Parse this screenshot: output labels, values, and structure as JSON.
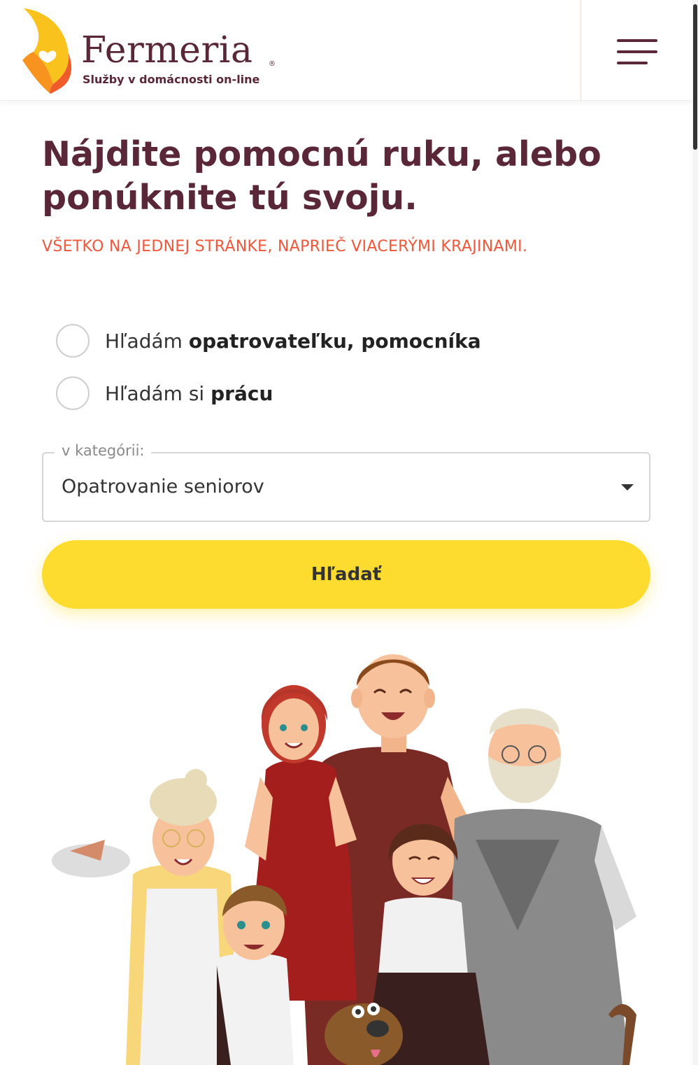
{
  "brand": {
    "name": "Fermeria",
    "registered": "®",
    "tagline": "Služby v domácnosti on-line",
    "colors": {
      "primary": "#5a2738",
      "accent": "#f0573b",
      "flame_yellow": "#f9c21c",
      "flame_orange": "#f26d2a"
    }
  },
  "header": {
    "menu_icon": "hamburger-menu-icon"
  },
  "hero": {
    "headline": "Nájdite pomocnú ruku, alebo ponúknite tú svoju.",
    "subheadline": "VŠETKO NA JEDNEJ STRÁNKE, NAPRIEČ VIACERÝMI KRAJINAMI."
  },
  "options": [
    {
      "prefix": "Hľadám ",
      "bold": "opatrovateľku, pomocníka",
      "selected": false
    },
    {
      "prefix": "Hľadám si ",
      "bold": "prácu",
      "selected": false
    }
  ],
  "category": {
    "legend": "v kategórii:",
    "value": "Opatrovanie seniorov"
  },
  "search_button": {
    "label": "Hľadať",
    "color": "#fedc2f"
  },
  "illustration": {
    "icon": "family-illustration"
  }
}
